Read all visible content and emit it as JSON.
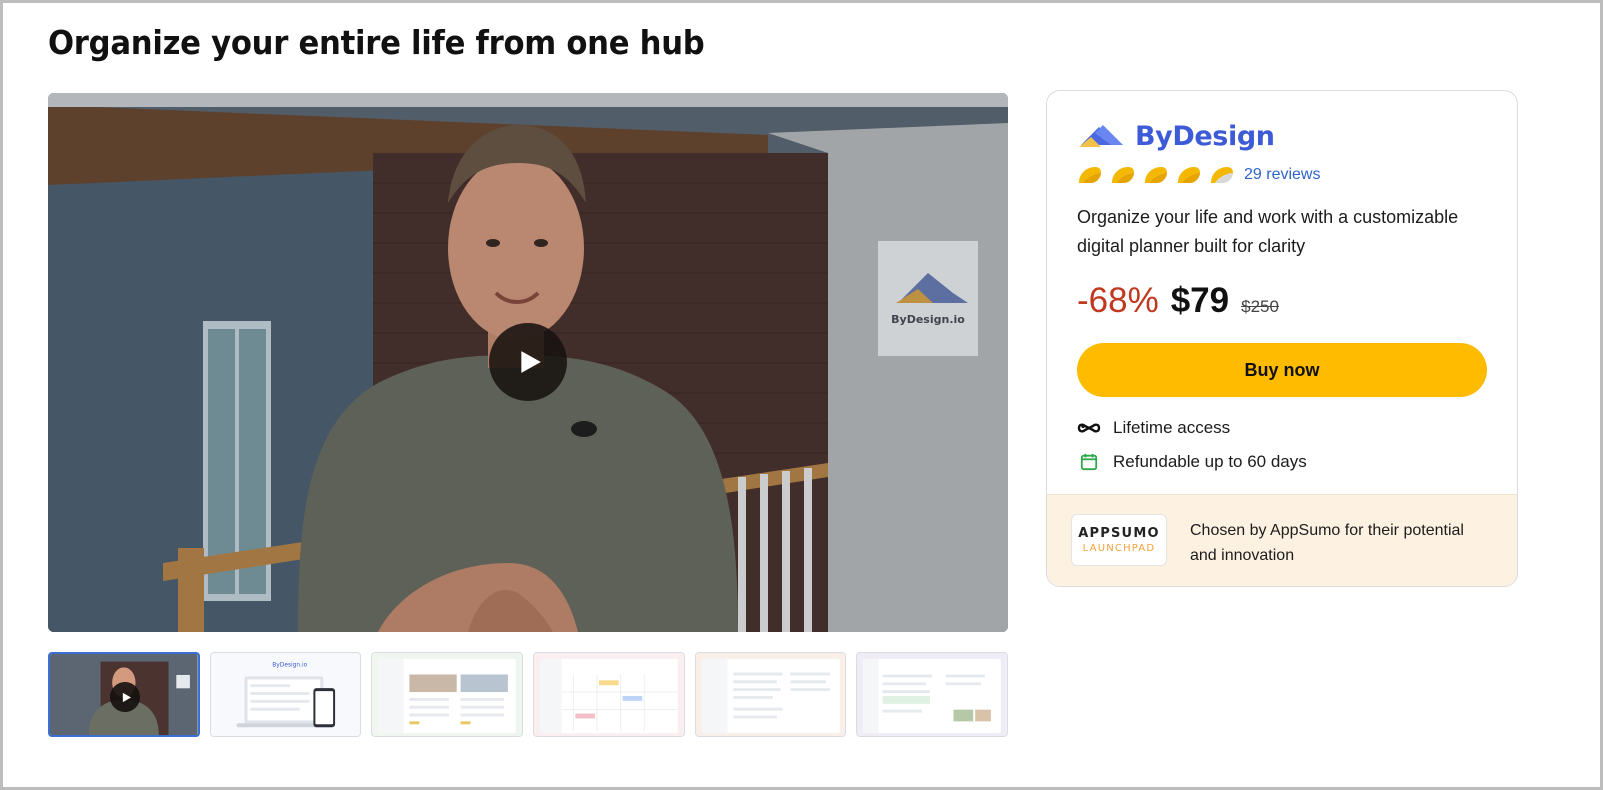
{
  "page": {
    "title": "Organize your entire life from one hub"
  },
  "video": {
    "play_icon": "play-icon",
    "poster_sign_text": "ByDesign.io"
  },
  "thumbnails": [
    {
      "kind": "video",
      "active": true
    },
    {
      "kind": "screenshot",
      "active": false
    },
    {
      "kind": "screenshot",
      "active": false
    },
    {
      "kind": "screenshot",
      "active": false
    },
    {
      "kind": "screenshot",
      "active": false
    },
    {
      "kind": "screenshot",
      "active": false
    }
  ],
  "thumbnail_brand": "ByDesign.io",
  "product": {
    "name": "ByDesign",
    "rating_stars": 5,
    "reviews_label": "29 reviews",
    "description": "Organize your life and work with a customizable digital planner built for clarity",
    "discount": "-68%",
    "price": "$79",
    "original_price": "$250",
    "buy_label": "Buy now",
    "features": [
      {
        "icon": "infinity-icon",
        "label": "Lifetime access"
      },
      {
        "icon": "calendar-check-icon",
        "label": "Refundable up to 60 days"
      }
    ],
    "launchpad": {
      "badge_top": "APPSUMO",
      "badge_bottom": "LAUNCHPAD",
      "text": "Chosen by AppSumo for their potential and innovation"
    }
  },
  "colors": {
    "brand_blue": "#3d5bd6",
    "buy_button": "#ffbb00",
    "discount_red": "#c0391f",
    "link_blue": "#2f64c8",
    "launchpad_bg": "#fdf1e2"
  }
}
